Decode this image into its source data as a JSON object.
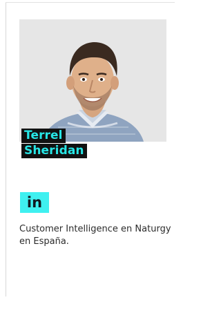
{
  "profile": {
    "name_line_1": "Terrel",
    "name_line_2": "Sheridan",
    "description": "Customer Intelligence en Naturgy en España.",
    "social": {
      "label": "in",
      "icon": "linkedin-icon"
    }
  },
  "colors": {
    "name_text": "#27e6e6",
    "name_bg": "#111111",
    "linkedin_bg": "#3ff0f0",
    "linkedin_text": "#101820",
    "description_text": "#2b2b2b"
  }
}
